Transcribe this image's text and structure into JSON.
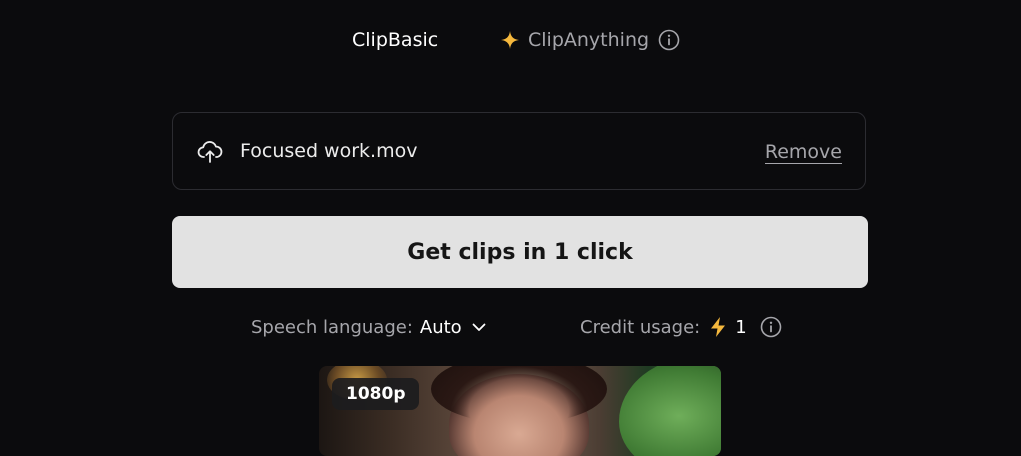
{
  "tabs": {
    "basic_label": "ClipBasic",
    "anything_label": "ClipAnything",
    "active": "ClipBasic"
  },
  "upload": {
    "file_name": "Focused work.mov",
    "remove_label": "Remove",
    "icon": "cloud-upload-icon"
  },
  "action": {
    "primary_label": "Get clips in 1 click"
  },
  "options": {
    "speech_language_label": "Speech language:",
    "speech_language_value": "Auto",
    "credit_usage_label": "Credit usage:",
    "credit_usage_value": "1"
  },
  "preview": {
    "resolution_badge": "1080p"
  },
  "colors": {
    "background": "#0b0b0d",
    "sparkle": "#f5b83d",
    "bolt": "#f5b83d",
    "button_bg": "#e2e2e2",
    "muted_text": "#a6a6ab"
  }
}
